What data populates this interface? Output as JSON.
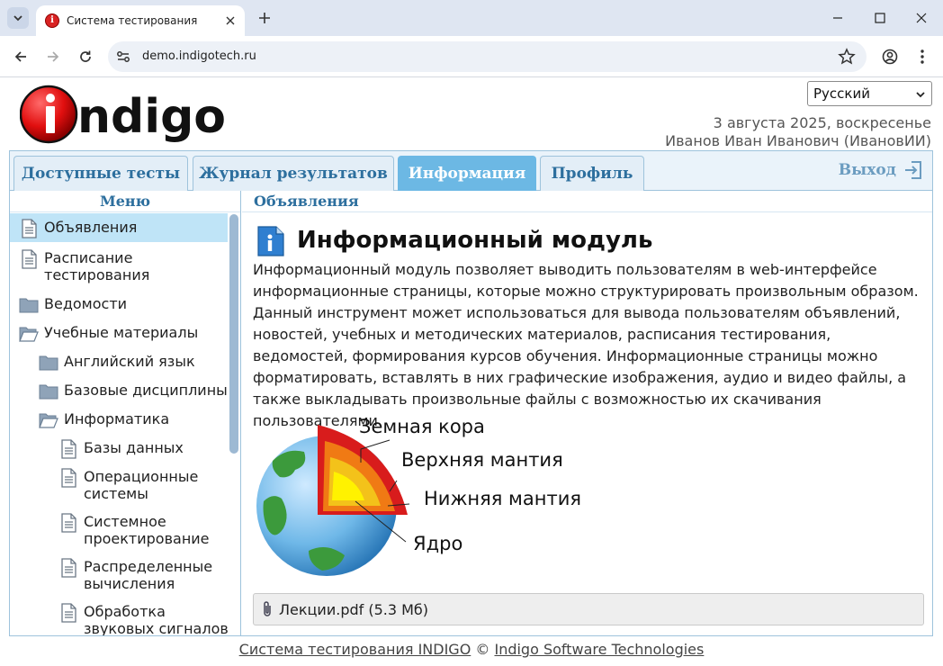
{
  "browser": {
    "tab_title": "Система тестирования",
    "url": "demo.indigotech.ru",
    "new_tab_symbol": "+"
  },
  "header": {
    "logo_text": "indigo",
    "language": "Русский",
    "date": "3 августа 2025, воскресенье",
    "user": "Иванов Иван Иванович (ИвановИИ)"
  },
  "tabs": {
    "available_tests": "Доступные тесты",
    "results_log": "Журнал результатов",
    "information": "Информация",
    "profile": "Профиль",
    "logout": "Выход"
  },
  "sidebar": {
    "header": "Меню",
    "items": [
      {
        "label": "Объявления",
        "icon": "document-icon"
      },
      {
        "label": "Расписание тестирования",
        "icon": "document-icon"
      },
      {
        "label": "Ведомости",
        "icon": "folder-icon"
      },
      {
        "label": "Учебные материалы",
        "icon": "folder-open-icon"
      },
      {
        "label": "Английский язык",
        "icon": "folder-icon"
      },
      {
        "label": "Базовые дисциплины",
        "icon": "folder-icon"
      },
      {
        "label": "Информатика",
        "icon": "folder-open-icon"
      },
      {
        "label": "Базы данных",
        "icon": "document-icon"
      },
      {
        "label": "Операционные системы",
        "icon": "document-icon"
      },
      {
        "label": "Системное проектирование",
        "icon": "document-icon"
      },
      {
        "label": "Распределенные вычисления",
        "icon": "document-icon"
      },
      {
        "label": "Обработка звуковых сигналов",
        "icon": "document-icon"
      }
    ]
  },
  "content": {
    "header": "Объявления",
    "title": "Информационный модуль",
    "body": "Информационный модуль позволяет выводить пользователям в web-интерфейсе информационные страницы, которые можно структурировать произвольным образом. Данный инструмент может использоваться для вывода пользователям объявлений, новостей, учебных и методических материалов, расписания тестирования, ведомостей, формирования курсов обучения. Информационные страницы можно форматировать, вставлять в них графические изображения, аудио и видео файлы, а также выкладывать произвольные файлы с возможностью их скачивания пользователями.",
    "earth_labels": {
      "crust": "Земная кора",
      "upper_mantle": "Верхняя мантия",
      "lower_mantle": "Нижняя мантия",
      "core": "Ядро"
    },
    "attachment": "Лекции.pdf (5.3 Мб)"
  },
  "footer": {
    "system": "Система тестирования INDIGO",
    "copyright": "©",
    "company": "Indigo Software Technologies"
  }
}
